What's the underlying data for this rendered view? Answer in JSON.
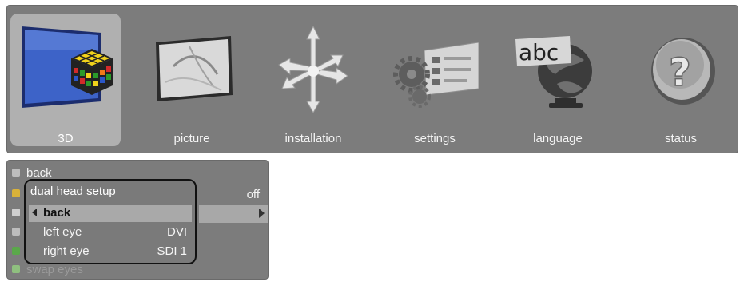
{
  "menu": {
    "items": [
      {
        "label": "3D",
        "icon": "rubiks-cube-3d-icon",
        "selected": true
      },
      {
        "label": "picture",
        "icon": "picture-icon"
      },
      {
        "label": "installation",
        "icon": "installation-arrows-icon"
      },
      {
        "label": "settings",
        "icon": "settings-gears-icon"
      },
      {
        "label": "language",
        "icon": "language-globe-icon"
      },
      {
        "label": "status",
        "icon": "status-question-icon"
      }
    ]
  },
  "submenu": {
    "back_label": "back",
    "value_off": "off",
    "last_label": "swap eyes"
  },
  "popup": {
    "title": "dual head setup",
    "back_label": "back",
    "rows": [
      {
        "label": "left eye",
        "value": "DVI"
      },
      {
        "label": "right eye",
        "value": "SDI 1"
      }
    ]
  },
  "colors": {
    "panel": "#7c7c7c",
    "highlight": "#b0b0b0",
    "popup_border": "#111111"
  }
}
